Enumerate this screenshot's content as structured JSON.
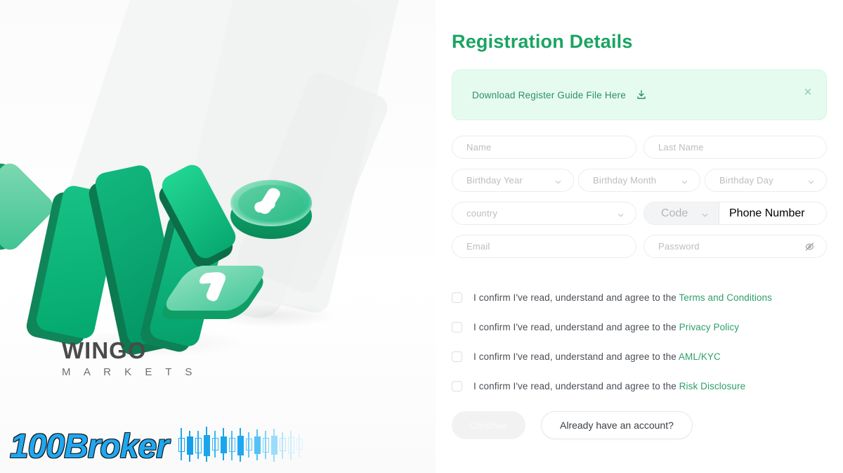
{
  "brand": {
    "name": "WINGO",
    "sub": "M A R K E T S"
  },
  "watermark": {
    "text": "100Broker"
  },
  "form": {
    "title": "Registration Details",
    "notice": {
      "text": "Download Register Guide File Here",
      "download_icon": "download-icon",
      "close_icon": "close-icon"
    },
    "fields": {
      "name": {
        "placeholder": "Name",
        "value": ""
      },
      "last_name": {
        "placeholder": "Last Name",
        "value": ""
      },
      "birthday_year": {
        "placeholder": "Birthday Year",
        "value": ""
      },
      "birthday_month": {
        "placeholder": "Birthday Month",
        "value": ""
      },
      "birthday_day": {
        "placeholder": "Birthday Day",
        "value": ""
      },
      "country": {
        "placeholder": "country",
        "value": ""
      },
      "phone_code": {
        "placeholder": "Code",
        "value": ""
      },
      "phone_number": {
        "placeholder": "Phone Number",
        "value": ""
      },
      "email": {
        "placeholder": "Email",
        "value": ""
      },
      "password": {
        "placeholder": "Password",
        "value": ""
      }
    },
    "consents": [
      {
        "prefix": "I confirm I've read, understand and agree to the ",
        "link": "Terms and Conditions",
        "checked": false
      },
      {
        "prefix": "I confirm I've read, understand and agree to the ",
        "link": "Privacy Policy",
        "checked": false
      },
      {
        "prefix": "I confirm I've read, understand and agree to the ",
        "link": "AML/KYC",
        "checked": false
      },
      {
        "prefix": "I confirm I've read, understand and agree to the ",
        "link": "Risk Disclosure",
        "checked": false
      }
    ],
    "actions": {
      "continue_label": "Continue",
      "account_label": "Already have an account?"
    }
  },
  "colors": {
    "accent_green": "#1aa463",
    "link_green": "#2e9e6b",
    "notice_bg": "#e6fbf0",
    "watermark_blue": "#1fa7ef"
  }
}
